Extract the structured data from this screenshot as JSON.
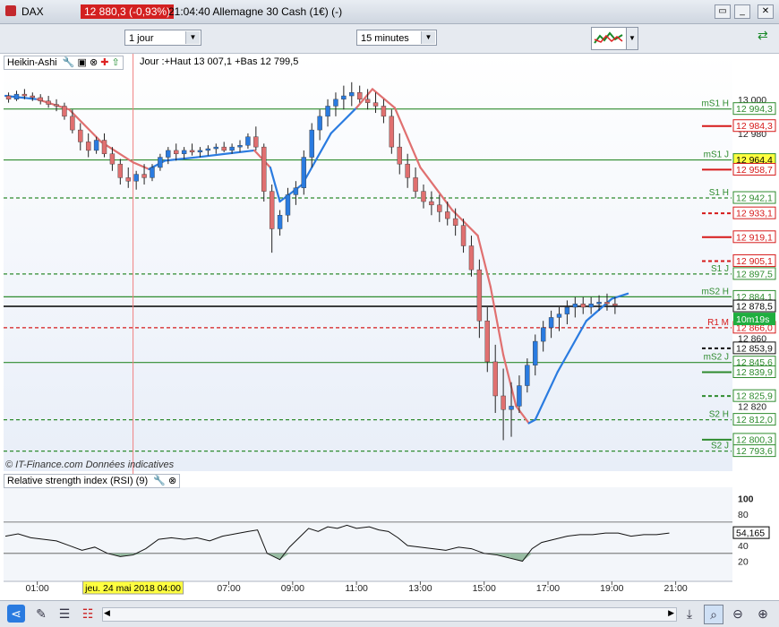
{
  "window": {
    "ticker": "DAX",
    "price_badge": "12 880,3 (-0,93%)",
    "caption": "21:04:40 Allemagne 30 Cash (1€) (-)"
  },
  "toolbar": {
    "period_select": "1 jour",
    "interval_select": "15 minutes"
  },
  "panel": {
    "indicator_name": "Heikin-Ashi",
    "info": "Jour :+Haut 13 007,1 +Bas 12 799,5",
    "watermark": "© IT-Finance.com  Données indicatives",
    "countdown": "10m19s",
    "rsi_title": "Relative strength index (RSI) (9)",
    "rsi_value": "54,165",
    "crosshair_date": "jeu. 24 mai 2018 04:00"
  },
  "colors": {
    "bull": "#2a7be0",
    "bear": "#e07070",
    "support": "#2e8b2e",
    "resistance": "#d61a1a",
    "crosshair": "#f08080"
  },
  "chart_data": {
    "type": "candlestick",
    "y_range": [
      12785,
      13012
    ],
    "y_ticks": [
      13000,
      12980,
      12960,
      12860,
      12840,
      12820
    ],
    "y_tick_labels": [
      "13 000",
      "12 980",
      "12 960",
      "12 860",
      "12 840",
      "12 820"
    ],
    "current_price": 12878.5,
    "current_price_label": "12 878,5",
    "x_tick_labels": [
      "01:00",
      "07:00",
      "09:00",
      "11:00",
      "13:00",
      "15:00",
      "17:00",
      "19:00",
      "21:00"
    ],
    "x_tick_hours": [
      1,
      7,
      9,
      11,
      13,
      15,
      17,
      19,
      21
    ],
    "x_range_hours": [
      0,
      21.6
    ],
    "crosshair_hour": 4,
    "levels": [
      {
        "label": "mS1 H",
        "value": 12994.3,
        "value_label": "12 994,3",
        "color": "support",
        "style": "solid"
      },
      {
        "label": "",
        "value": 12984.3,
        "value_label": "12 984,3",
        "color": "resistance",
        "style": "solid"
      },
      {
        "label": "mS1 J",
        "value": 12964.4,
        "value_label": "12 964,4",
        "color": "support",
        "style": "solid",
        "highlight": true
      },
      {
        "label": "",
        "value": 12958.7,
        "value_label": "12 958,7",
        "color": "resistance",
        "style": "solid"
      },
      {
        "label": "S1 H",
        "value": 12942.1,
        "value_label": "12 942,1",
        "color": "support",
        "style": "dashed"
      },
      {
        "label": "",
        "value": 12933.1,
        "value_label": "12 933,1",
        "color": "resistance",
        "style": "dashed"
      },
      {
        "label": "",
        "value": 12919.1,
        "value_label": "12 919,1",
        "color": "resistance",
        "style": "solid"
      },
      {
        "label": "",
        "value": 12905.1,
        "value_label": "12 905,1",
        "color": "resistance",
        "style": "dashed"
      },
      {
        "label": "S1 J",
        "value": 12897.5,
        "value_label": "12 897,5",
        "color": "support",
        "style": "dashed"
      },
      {
        "label": "mS2 H",
        "value": 12884.1,
        "value_label": "12 884,1",
        "color": "support",
        "style": "solid"
      },
      {
        "label": "R1 M",
        "value": 12866.0,
        "value_label": "12 866,0",
        "color": "resistance",
        "style": "dashed"
      },
      {
        "label": "",
        "value": 12853.9,
        "value_label": "12 853,9",
        "color": "black",
        "style": "dashed"
      },
      {
        "label": "mS2 J",
        "value": 12845.6,
        "value_label": "12 845,6",
        "color": "support",
        "style": "solid"
      },
      {
        "label": "",
        "value": 12839.9,
        "value_label": "12 839,9",
        "color": "support",
        "style": "solid"
      },
      {
        "label": "",
        "value": 12825.9,
        "value_label": "12 825,9",
        "color": "support",
        "style": "dashed"
      },
      {
        "label": "S2 H",
        "value": 12812.0,
        "value_label": "12 812,0",
        "color": "support",
        "style": "dashed"
      },
      {
        "label": "",
        "value": 12800.3,
        "value_label": "12 800,3",
        "color": "support",
        "style": "solid"
      },
      {
        "label": "S2 J",
        "value": 12793.6,
        "value_label": "12 793,6",
        "color": "support",
        "style": "dashed"
      }
    ],
    "candles": [
      [
        0.1,
        13002,
        13004,
        12998,
        13000
      ],
      [
        0.35,
        13000,
        13005,
        12999,
        13003
      ],
      [
        0.6,
        13003,
        13006,
        13000,
        13002
      ],
      [
        0.85,
        13002,
        13004,
        12999,
        13001
      ],
      [
        1.1,
        13001,
        13003,
        12997,
        12999
      ],
      [
        1.35,
        12999,
        13002,
        12995,
        12997
      ],
      [
        1.6,
        12997,
        13000,
        12993,
        12996
      ],
      [
        1.85,
        12996,
        12998,
        12988,
        12990
      ],
      [
        2.1,
        12990,
        12994,
        12980,
        12982
      ],
      [
        2.35,
        12982,
        12986,
        12970,
        12975
      ],
      [
        2.6,
        12975,
        12980,
        12966,
        12970
      ],
      [
        2.85,
        12970,
        12978,
        12968,
        12976
      ],
      [
        3.1,
        12976,
        12980,
        12966,
        12968
      ],
      [
        3.35,
        12968,
        12972,
        12958,
        12962
      ],
      [
        3.6,
        12962,
        12965,
        12950,
        12954
      ],
      [
        3.85,
        12954,
        12960,
        12948,
        12952
      ],
      [
        4.1,
        12952,
        12958,
        12947,
        12956
      ],
      [
        4.35,
        12956,
        12962,
        12950,
        12954
      ],
      [
        4.6,
        12954,
        12962,
        12952,
        12960
      ],
      [
        4.85,
        12960,
        12968,
        12958,
        12966
      ],
      [
        5.1,
        12966,
        12972,
        12962,
        12970
      ],
      [
        5.35,
        12970,
        12974,
        12964,
        12968
      ],
      [
        5.6,
        12968,
        12972,
        12965,
        12970
      ],
      [
        5.85,
        12970,
        12974,
        12967,
        12969
      ],
      [
        6.1,
        12969,
        12972,
        12966,
        12970
      ],
      [
        6.35,
        12970,
        12973,
        12967,
        12971
      ],
      [
        6.6,
        12971,
        12974,
        12968,
        12972
      ],
      [
        6.85,
        12972,
        12975,
        12969,
        12970
      ],
      [
        7.1,
        12970,
        12974,
        12968,
        12972
      ],
      [
        7.35,
        12972,
        12976,
        12969,
        12973
      ],
      [
        7.6,
        12973,
        12980,
        12971,
        12978
      ],
      [
        7.85,
        12978,
        12984,
        12970,
        12972
      ],
      [
        8.1,
        12972,
        12974,
        12940,
        12946
      ],
      [
        8.35,
        12946,
        12950,
        12910,
        12924
      ],
      [
        8.6,
        12924,
        12935,
        12920,
        12932
      ],
      [
        8.85,
        12932,
        12948,
        12928,
        12944
      ],
      [
        9.1,
        12944,
        12952,
        12938,
        12948
      ],
      [
        9.35,
        12948,
        12970,
        12944,
        12966
      ],
      [
        9.6,
        12966,
        12986,
        12960,
        12982
      ],
      [
        9.85,
        12982,
        12994,
        12976,
        12990
      ],
      [
        10.1,
        12990,
        13000,
        12984,
        12996
      ],
      [
        10.35,
        12996,
        13004,
        12990,
        13000
      ],
      [
        10.6,
        13000,
        13008,
        12994,
        13002
      ],
      [
        10.85,
        13002,
        13010,
        12996,
        13004
      ],
      [
        11.1,
        13004,
        13008,
        12998,
        13000
      ],
      [
        11.35,
        13000,
        13006,
        12994,
        12998
      ],
      [
        11.6,
        12998,
        13004,
        12992,
        12996
      ],
      [
        11.85,
        12996,
        13000,
        12986,
        12990
      ],
      [
        12.1,
        12990,
        12994,
        12968,
        12972
      ],
      [
        12.35,
        12972,
        12980,
        12956,
        12962
      ],
      [
        12.6,
        12962,
        12968,
        12948,
        12954
      ],
      [
        12.85,
        12954,
        12960,
        12942,
        12946
      ],
      [
        13.1,
        12946,
        12950,
        12936,
        12940
      ],
      [
        13.35,
        12940,
        12946,
        12932,
        12938
      ],
      [
        13.6,
        12938,
        12944,
        12928,
        12934
      ],
      [
        13.85,
        12934,
        12940,
        12926,
        12930
      ],
      [
        14.1,
        12930,
        12936,
        12920,
        12926
      ],
      [
        14.35,
        12926,
        12930,
        12910,
        12914
      ],
      [
        14.6,
        12914,
        12920,
        12896,
        12900
      ],
      [
        14.85,
        12900,
        12906,
        12860,
        12870
      ],
      [
        15.1,
        12870,
        12878,
        12840,
        12846
      ],
      [
        15.35,
        12846,
        12856,
        12816,
        12826
      ],
      [
        15.6,
        12826,
        12842,
        12800,
        12818
      ],
      [
        15.85,
        12818,
        12834,
        12802,
        12820
      ],
      [
        16.1,
        12820,
        12838,
        12816,
        12832
      ],
      [
        16.35,
        12832,
        12848,
        12828,
        12844
      ],
      [
        16.6,
        12844,
        12862,
        12838,
        12858
      ],
      [
        16.85,
        12858,
        12870,
        12852,
        12866
      ],
      [
        17.1,
        12866,
        12876,
        12860,
        12872
      ],
      [
        17.35,
        12872,
        12878,
        12864,
        12874
      ],
      [
        17.6,
        12874,
        12882,
        12868,
        12878
      ],
      [
        17.85,
        12878,
        12884,
        12872,
        12880
      ],
      [
        18.1,
        12880,
        12884,
        12874,
        12878
      ],
      [
        18.35,
        12878,
        12884,
        12874,
        12880
      ],
      [
        18.6,
        12880,
        12885,
        12876,
        12881
      ],
      [
        18.85,
        12881,
        12886,
        12876,
        12880
      ],
      [
        19.1,
        12880,
        12884,
        12874,
        12879
      ]
    ],
    "supertrend": [
      [
        0.0,
        13002,
        "bull"
      ],
      [
        1.0,
        13000,
        "bull"
      ],
      [
        2.0,
        12994,
        "bear"
      ],
      [
        3.0,
        12975,
        "bear"
      ],
      [
        4.0,
        12963,
        "bear"
      ],
      [
        4.5,
        12959,
        "bear"
      ],
      [
        5.0,
        12964,
        "bull"
      ],
      [
        6.0,
        12966,
        "bull"
      ],
      [
        7.8,
        12970,
        "bull"
      ],
      [
        8.3,
        12960,
        "bear"
      ],
      [
        8.6,
        12940,
        "bull"
      ],
      [
        9.3,
        12950,
        "bull"
      ],
      [
        10.2,
        12980,
        "bull"
      ],
      [
        11.0,
        12995,
        "bull"
      ],
      [
        11.5,
        13006,
        "bear"
      ],
      [
        12.2,
        12995,
        "bear"
      ],
      [
        13.0,
        12960,
        "bear"
      ],
      [
        14.0,
        12935,
        "bear"
      ],
      [
        14.8,
        12920,
        "bear"
      ],
      [
        15.2,
        12890,
        "bear"
      ],
      [
        15.6,
        12850,
        "bear"
      ],
      [
        16.0,
        12820,
        "bear"
      ],
      [
        16.4,
        12810,
        "bear"
      ],
      [
        16.6,
        12812,
        "bull"
      ],
      [
        17.3,
        12840,
        "bull"
      ],
      [
        18.2,
        12870,
        "bull"
      ],
      [
        19.0,
        12883,
        "bull"
      ],
      [
        19.5,
        12886,
        "bull"
      ]
    ],
    "rsi": {
      "range": [
        0,
        110
      ],
      "tick_labels": [
        "100",
        "80",
        "60",
        "40",
        "20"
      ],
      "ticks": [
        100,
        80,
        60,
        40,
        20
      ],
      "levels": [
        70,
        30
      ],
      "values": [
        [
          0.0,
          52
        ],
        [
          0.4,
          55
        ],
        [
          0.8,
          50
        ],
        [
          1.2,
          48
        ],
        [
          1.6,
          46
        ],
        [
          2.0,
          40
        ],
        [
          2.4,
          34
        ],
        [
          2.8,
          38
        ],
        [
          3.2,
          30
        ],
        [
          3.6,
          26
        ],
        [
          4.0,
          28
        ],
        [
          4.4,
          36
        ],
        [
          4.8,
          48
        ],
        [
          5.2,
          50
        ],
        [
          5.6,
          48
        ],
        [
          6.0,
          50
        ],
        [
          6.4,
          46
        ],
        [
          6.8,
          52
        ],
        [
          7.2,
          55
        ],
        [
          7.6,
          58
        ],
        [
          7.9,
          60
        ],
        [
          8.2,
          30
        ],
        [
          8.6,
          22
        ],
        [
          8.9,
          38
        ],
        [
          9.2,
          50
        ],
        [
          9.5,
          62
        ],
        [
          9.8,
          58
        ],
        [
          10.1,
          64
        ],
        [
          10.4,
          62
        ],
        [
          10.7,
          66
        ],
        [
          11.0,
          62
        ],
        [
          11.4,
          64
        ],
        [
          11.7,
          60
        ],
        [
          12.0,
          58
        ],
        [
          12.3,
          50
        ],
        [
          12.6,
          40
        ],
        [
          13.0,
          38
        ],
        [
          13.4,
          36
        ],
        [
          13.8,
          34
        ],
        [
          14.2,
          38
        ],
        [
          14.6,
          36
        ],
        [
          15.0,
          30
        ],
        [
          15.4,
          28
        ],
        [
          15.8,
          24
        ],
        [
          16.2,
          20
        ],
        [
          16.5,
          36
        ],
        [
          16.8,
          44
        ],
        [
          17.2,
          48
        ],
        [
          17.6,
          52
        ],
        [
          18.0,
          54
        ],
        [
          18.4,
          54
        ],
        [
          18.8,
          56
        ],
        [
          19.2,
          56
        ],
        [
          19.6,
          52
        ],
        [
          20.0,
          54
        ],
        [
          20.4,
          54
        ],
        [
          20.8,
          56
        ]
      ]
    }
  }
}
